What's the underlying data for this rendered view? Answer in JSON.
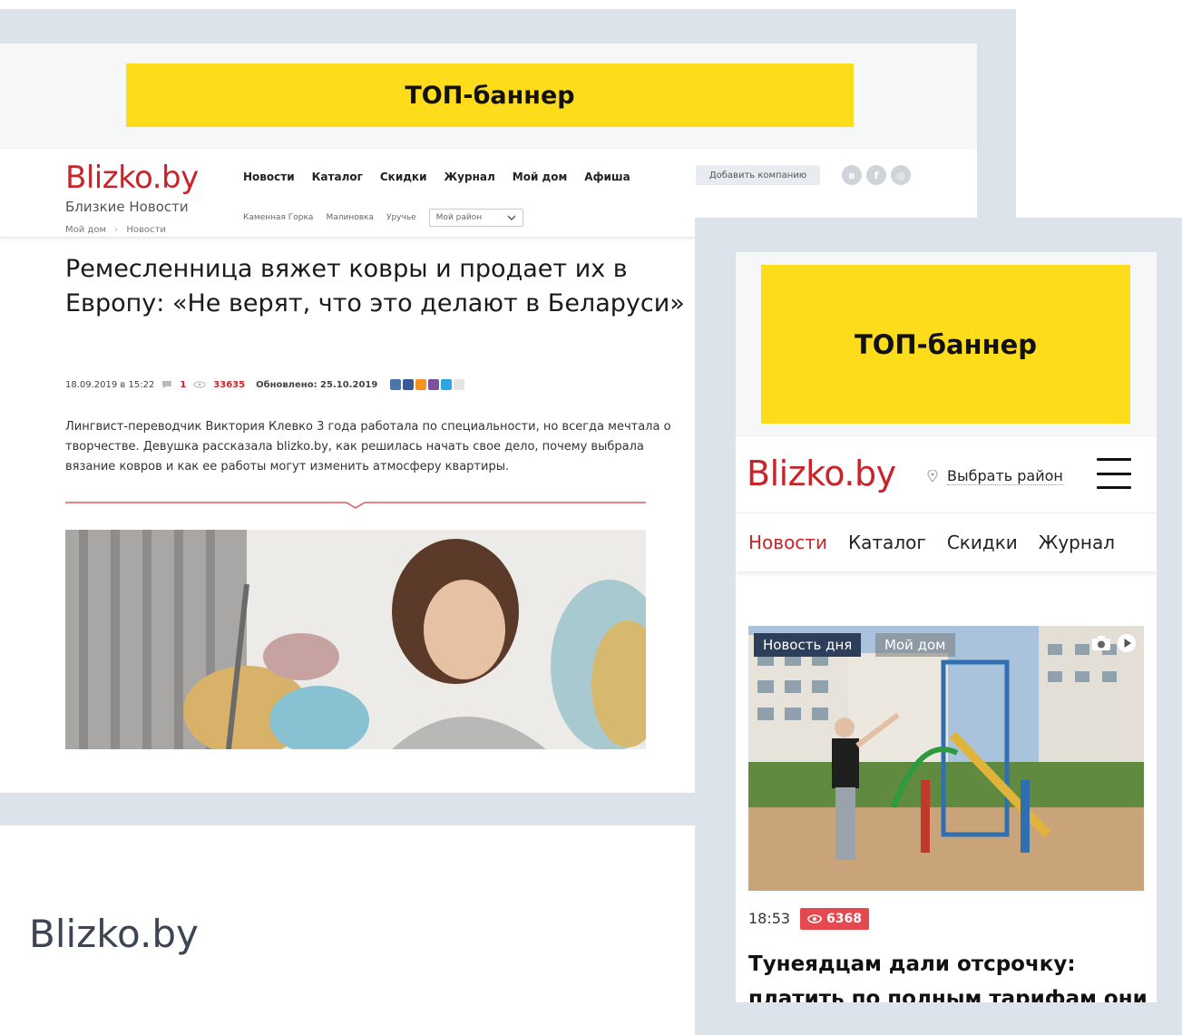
{
  "desktop": {
    "banner": "ТОП-баннер",
    "logo": "Blizko.by",
    "tagline": "Близкие Новости",
    "nav": [
      "Новости",
      "Каталог",
      "Скидки",
      "Журнал",
      "Мой дом",
      "Афиша"
    ],
    "subnav": [
      "Каменная Горка",
      "Малиновка",
      "Уручье"
    ],
    "district_select": "Мой район",
    "add_company": "Добавить компанию",
    "breadcrumbs": [
      "Мой дом",
      "Новости"
    ],
    "breadcrumb_sep": "›",
    "title": "Ремесленница вяжет ковры и продает их в Европу: «Не верят, что это делают в Беларуси»",
    "meta": {
      "date": "18.09.2019 в 15:22",
      "comments": "1",
      "views": "33635",
      "updated": "Обновлено: 25.10.2019"
    },
    "lead": "Лингвист-переводчик Виктория Клевко 3 года работала по специальности, но всегда мечтала о творчестве. Девушка рассказала blizko.by, как решилась начать свое дело, почему выбрала вязание ковров и как ее работы могут изменить атмосферу квартиры."
  },
  "mobile": {
    "banner": "ТОП-баннер",
    "logo": "Blizko.by",
    "district": "Выбрать район",
    "nav": [
      "Новости",
      "Каталог",
      "Скидки",
      "Журнал"
    ],
    "active_nav": "Новости",
    "tags": [
      "Новость дня",
      "Мой дом"
    ],
    "time": "18:53",
    "views": "6368",
    "headline": "Тунеядцам дали отсрочку: платить по полным тарифам они"
  },
  "caption": "Blizko.by",
  "colors": {
    "brand_red": "#c9242a",
    "banner_yellow": "#fcdc1b",
    "frame_bg": "#dde3ea",
    "views_badge": "#e6484f"
  }
}
